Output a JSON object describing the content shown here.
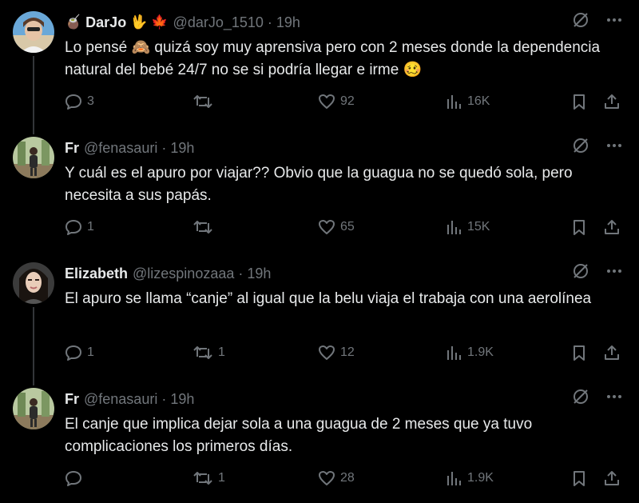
{
  "tweets": [
    {
      "name": "DarJo",
      "name_emojis": [
        "🧉",
        "🖖",
        "🍁"
      ],
      "handle": "@darJo_1510",
      "time": "19h",
      "text": "Lo pensé 🙈 quizá soy muy aprensiva pero con 2 meses donde la dependencia natural del bebé 24/7 no se si podría llegar e irme 🥴",
      "replies": "3",
      "retweets": "",
      "likes": "92",
      "views": "16K"
    },
    {
      "name": "Fr",
      "name_emojis": [],
      "handle": "@fenasauri",
      "time": "19h",
      "text": "Y cuál es el apuro por viajar?? Obvio que la guagua no se quedó sola, pero necesita a sus papás.",
      "replies": "1",
      "retweets": "",
      "likes": "65",
      "views": "15K"
    },
    {
      "name": "Elizabeth",
      "name_emojis": [],
      "handle": "@lizespinozaaa",
      "time": "19h",
      "text": "El apuro se llama “canje” al igual que la belu viaja el trabaja con una aerolínea",
      "replies": "1",
      "retweets": "1",
      "likes": "12",
      "views": "1.9K"
    },
    {
      "name": "Fr",
      "name_emojis": [],
      "handle": "@fenasauri",
      "time": "19h",
      "text": "El canje que implica dejar sola a una guagua de 2 meses que ya tuvo complicaciones los primeros días.",
      "replies": "",
      "retweets": "1",
      "likes": "28",
      "views": "1.9K"
    }
  ],
  "dot": "·",
  "icons": {
    "grok": "grok-icon",
    "more": "more-icon",
    "reply": "reply-icon",
    "retweet": "retweet-icon",
    "like": "heart-icon",
    "views": "views-icon",
    "bookmark": "bookmark-icon",
    "share": "share-icon"
  },
  "colors": {
    "background": "#000000",
    "text": "#e7e9ea",
    "muted": "#71767b",
    "thread": "#333639"
  }
}
